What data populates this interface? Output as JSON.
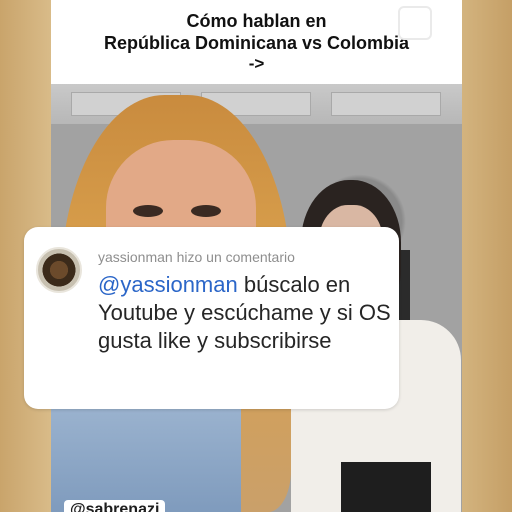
{
  "banner": {
    "line1": "Cómo hablan en",
    "line2": "República Dominicana vs Colombia",
    "line3": "->"
  },
  "comment": {
    "header": "yassionman hizo un comentario",
    "mention": "@yassionman",
    "text_after_mention": " búscalo en Youtube y escúchame y si OS gusta like y subscribirse"
  },
  "bottom_tag": "@sabrenazi",
  "icons": {
    "avatar": "profile-avatar",
    "square": "square-outline-icon"
  }
}
